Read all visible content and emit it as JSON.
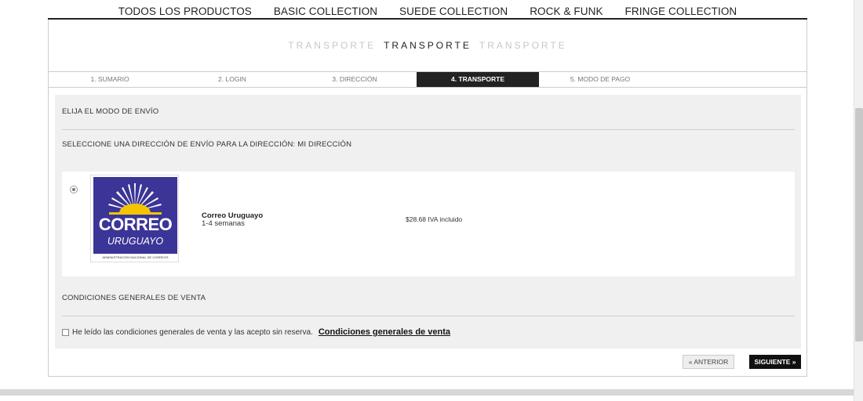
{
  "nav": {
    "items": [
      "TODOS LOS PRODUCTOS",
      "BASIC COLLECTION",
      "SUEDE COLLECTION",
      "ROCK & FUNK",
      "FRINGE COLLECTION"
    ]
  },
  "page": {
    "title_left": "TRANSPORTE",
    "title_main": "TRANSPORTE",
    "title_right": "TRANSPORTE"
  },
  "steps": {
    "items": [
      "1. SUMARIO",
      "2. LOGIN",
      "3. DIRECCIÓN",
      "4. TRANSPORTE",
      "5. MODO DE PAGO"
    ],
    "active_index": 3
  },
  "shipping": {
    "heading": "ELIJA EL MODO DE ENVÍO",
    "address_heading": "SELECCIONE UNA DIRECCIÓN DE ENVÍO PARA LA DIRECCIÓN: MI DIRECCIÓN",
    "carrier": {
      "selected": true,
      "logo_word1": "CORREO",
      "logo_word2": "URUGUAYO",
      "logo_word3": "ADMINISTRACIÓN NACIONAL DE CORREOS",
      "name": "Correo Uruguayo",
      "delay": "1-4 semanas",
      "price": "$28.68 IVA incluido"
    }
  },
  "terms": {
    "heading": "CONDICIONES GENERALES DE VENTA",
    "checkbox_label": "He leído las condiciones generales de venta y las acepto sin reserva.",
    "link_label": "Condiciones generales de venta",
    "checked": false
  },
  "buttons": {
    "previous": "« ANTERIOR",
    "next": "SIGUIENTE »"
  },
  "colors": {
    "active_step": "#222222",
    "logo_blue": "#3b3597",
    "panel_bg": "#f0f0f0"
  }
}
